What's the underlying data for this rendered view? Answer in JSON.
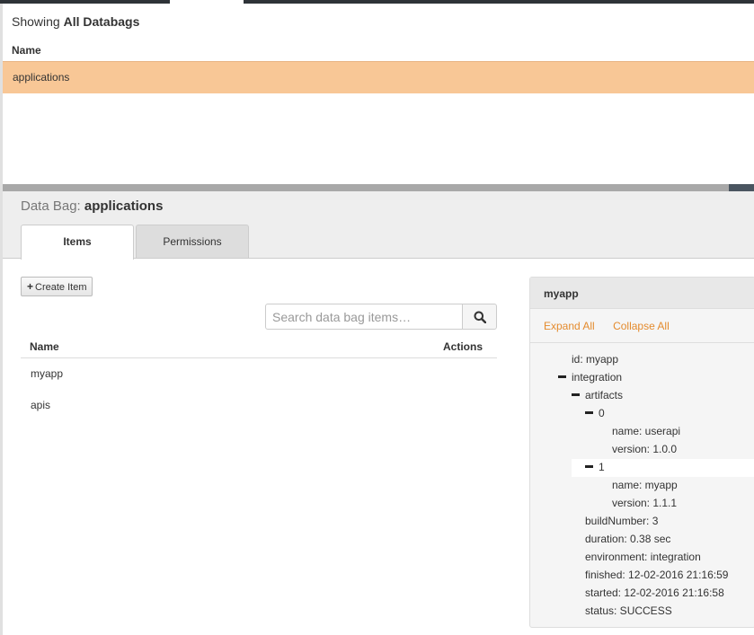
{
  "top": {
    "showing_prefix": "Showing",
    "showing_bold": "All Databags",
    "list_header": "Name",
    "rows": [
      "applications"
    ]
  },
  "databag": {
    "label": "Data Bag:",
    "name": "applications"
  },
  "tabs": [
    {
      "label": "Items",
      "active": true
    },
    {
      "label": "Permissions",
      "active": false
    }
  ],
  "items_panel": {
    "create_label": "Create Item",
    "search_placeholder": "Search data bag items…",
    "col_name": "Name",
    "col_actions": "Actions",
    "rows": [
      "myapp",
      "apis"
    ]
  },
  "detail": {
    "title": "myapp",
    "expand_all": "Expand All",
    "collapse_all": "Collapse All",
    "tree": [
      "id: myapp",
      "integration",
      "artifacts",
      "0",
      "name: userapi",
      "version: 1.0.0",
      "1",
      "name: myapp",
      "version: 1.1.1",
      "buildNumber: 3",
      "duration: 0.38 sec",
      "environment: integration",
      "finished: 12-02-2016 21:16:59",
      "started: 12-02-2016 21:16:58",
      "status: SUCCESS"
    ]
  },
  "colors": {
    "selected_row": "#f8c796",
    "link": "#e48b2e",
    "header_dark": "#2e3338"
  }
}
